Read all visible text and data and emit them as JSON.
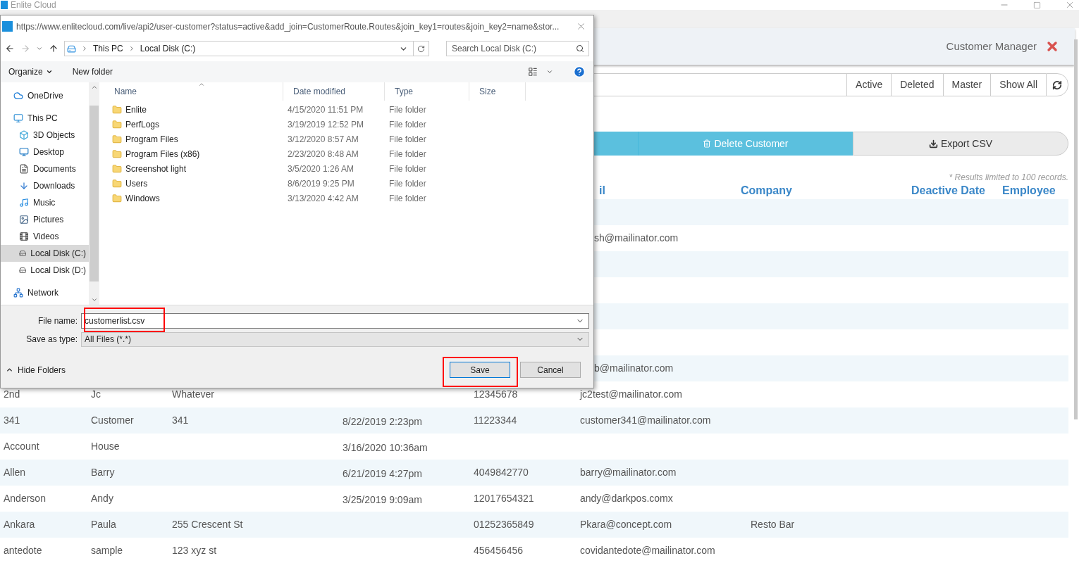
{
  "app": {
    "title": "Enlite Cloud",
    "header": "Customer Manager",
    "filters": [
      {
        "label": "Active"
      },
      {
        "label": "Deleted"
      },
      {
        "label": "Master"
      },
      {
        "label": "Show All"
      }
    ],
    "actions": [
      {
        "kind": "delete",
        "label": "Delete Customer"
      },
      {
        "kind": "export",
        "label": "Export CSV"
      }
    ],
    "note": "* Results limited to 100 records.",
    "columns": [
      "il",
      "Company",
      "Deactive Date",
      "Employee"
    ],
    "rows": [
      {},
      {
        "email": "sh@mailinator.com"
      },
      {},
      {},
      {},
      {},
      {
        "email": "b@mailinator.com"
      },
      {
        "last_name": "2nd",
        "first_name": "Jc",
        "address": "Whatever",
        "phone": "12345678",
        "email": "jc2test@mailinator.com"
      },
      {
        "last_name": "341",
        "first_name": "Customer",
        "address": "341",
        "date": "8/22/2019 2:23pm",
        "phone": "11223344",
        "email": "customer341@mailinator.com"
      },
      {
        "last_name": "Account",
        "first_name": "House",
        "date": "3/16/2020 10:36am"
      },
      {
        "last_name": "Allen",
        "first_name": "Barry",
        "date": "6/21/2019 4:27pm",
        "phone": "4049842770",
        "email": "barry@mailinator.com"
      },
      {
        "last_name": "Anderson",
        "first_name": "Andy",
        "date": "3/25/2019 9:09am",
        "phone": "12017654321",
        "email": "andy@darkpos.comx"
      },
      {
        "last_name": "Ankara",
        "first_name": "Paula",
        "address": "255 Crescent St",
        "phone": "01252365849",
        "email": "Pkara@concept.com",
        "company": "Resto Bar"
      },
      {
        "last_name": "antedote",
        "first_name": "sample",
        "address": "123 xyz st",
        "phone": "456456456",
        "email": "covidantedote@mailinator.com"
      }
    ]
  },
  "dialog": {
    "title": "https://www.enlitecloud.com/live/api2/user-customer?status=active&add_join=CustomerRoute.Routes&join_key1=routes&join_key2=name&stor...",
    "path": [
      "This PC",
      "Local Disk (C:)"
    ],
    "search": {
      "placeholder": "Search Local Disk (C:)"
    },
    "toolbar": {
      "organize": "Organize",
      "new_folder": "New folder"
    },
    "nav": [
      {
        "label": "OneDrive",
        "selected": false
      },
      {
        "label": "This PC",
        "selected": false,
        "children": [
          {
            "label": "3D Objects",
            "selected": false
          },
          {
            "label": "Desktop",
            "selected": false
          },
          {
            "label": "Documents",
            "selected": false
          },
          {
            "label": "Downloads",
            "selected": false
          },
          {
            "label": "Music",
            "selected": false
          },
          {
            "label": "Pictures",
            "selected": false
          },
          {
            "label": "Videos",
            "selected": false
          },
          {
            "label": "Local Disk (C:)",
            "selected": true
          },
          {
            "label": "Local Disk  (D:)",
            "selected": false
          }
        ]
      },
      {
        "label": "Network",
        "selected": false
      }
    ],
    "columns": [
      "Name",
      "Date modified",
      "Type",
      "Size"
    ],
    "files": [
      {
        "name": "Enlite",
        "date": "4/15/2020 11:51 PM",
        "type": "File folder"
      },
      {
        "name": "PerfLogs",
        "date": "3/19/2019 12:52 PM",
        "type": "File folder"
      },
      {
        "name": "Program Files",
        "date": "3/12/2020 8:57 AM",
        "type": "File folder"
      },
      {
        "name": "Program Files (x86)",
        "date": "2/23/2020 8:48 AM",
        "type": "File folder"
      },
      {
        "name": "Screenshot light",
        "date": "3/5/2020 1:26 AM",
        "type": "File folder"
      },
      {
        "name": "Users",
        "date": "8/6/2019 9:25 PM",
        "type": "File folder"
      },
      {
        "name": "Windows",
        "date": "3/13/2020 4:42 AM",
        "type": "File folder"
      }
    ],
    "file_name": {
      "label": "File name:",
      "value": "customerlist.csv"
    },
    "save_type": {
      "label": "Save as type:",
      "value": "All Files (*.*)"
    },
    "hide_folders": "Hide Folders",
    "buttons": [
      {
        "kind": "primary",
        "label": "Save"
      },
      {
        "kind": "normal",
        "label": "Cancel"
      }
    ]
  }
}
